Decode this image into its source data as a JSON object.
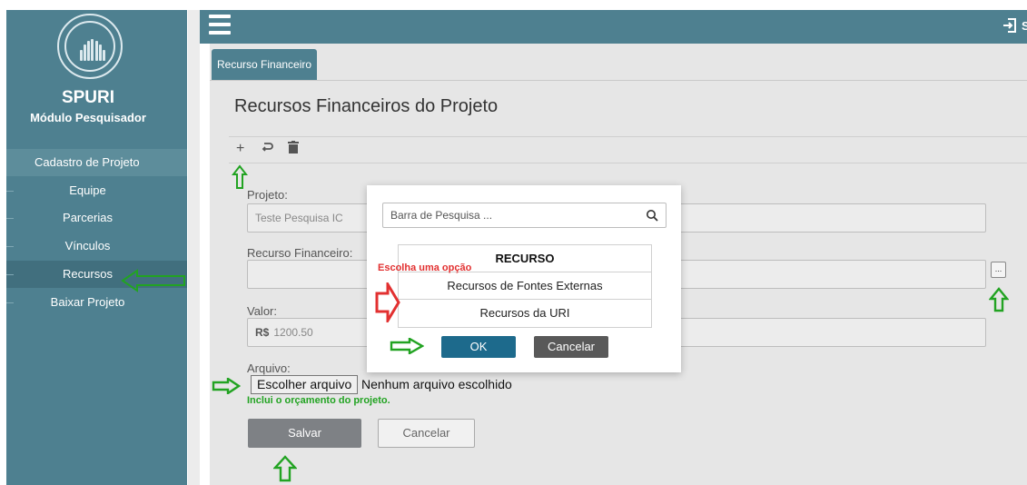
{
  "sidebar": {
    "app_title": "SPURI",
    "app_subtitle": "Módulo Pesquisador",
    "section": "Cadastro de Projeto",
    "items": [
      {
        "label": "Equipe"
      },
      {
        "label": "Parcerias"
      },
      {
        "label": "Vínculos"
      },
      {
        "label": "Recursos"
      },
      {
        "label": "Baixar Projeto"
      }
    ]
  },
  "topbar": {
    "logout_text": "S"
  },
  "tab": {
    "label": "Recurso Financeiro"
  },
  "page": {
    "title": "Recursos Financeiros do Projeto",
    "toolbar": {
      "add_icon": "plus-icon",
      "undo_icon": "undo-icon",
      "delete_icon": "trash-icon"
    },
    "fields": {
      "projeto_label": "Projeto:",
      "projeto_value": "Teste Pesquisa IC",
      "recurso_label": "Recurso Financeiro:",
      "recurso_value": "",
      "ellipsis": "...",
      "valor_label": "Valor:",
      "valor_currency": "R$",
      "valor_value": "1200.50",
      "arquivo_label": "Arquivo:",
      "file_button": "Escolher arquivo",
      "file_status": "Nenhum arquivo escolhido",
      "hint": "Inclui o orçamento do projeto."
    },
    "buttons": {
      "save": "Salvar",
      "cancel": "Cancelar"
    }
  },
  "modal": {
    "search_placeholder": "Barra de Pesquisa ...",
    "table_header": "RECURSO",
    "options": [
      "Recursos de Fontes Externas",
      "Recursos da URI"
    ],
    "ok": "OK",
    "cancel": "Cancelar"
  },
  "annotation": {
    "red_text": "Escolha uma opção",
    "green_color": "#22a322",
    "red_color": "#e23030"
  },
  "colors": {
    "primary": "#4e8090",
    "sidebar_active": "#416f7e",
    "ok_button": "#1d6a8c"
  }
}
